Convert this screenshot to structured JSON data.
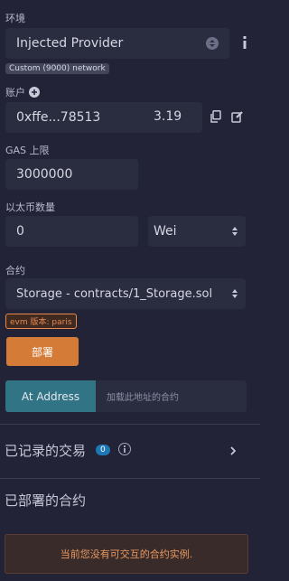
{
  "environment": {
    "label": "环境",
    "provider": "Injected Provider",
    "network_badge": "Custom (9000) network"
  },
  "account": {
    "label": "账户",
    "address": "0xffe...78513",
    "balance": "3.19"
  },
  "gas": {
    "label": "GAS 上限",
    "value": "3000000"
  },
  "value": {
    "label": "以太币数量",
    "amount": "0",
    "unit": "Wei"
  },
  "contract": {
    "label": "合约",
    "selected": "Storage - contracts/1_Storage.sol",
    "evm_badge": "evm 版本: paris"
  },
  "deploy": {
    "button": "部署"
  },
  "at_address": {
    "button": "At Address",
    "placeholder": "加载此地址的合约"
  },
  "transactions": {
    "title": "已记录的交易",
    "count": "0"
  },
  "deployed": {
    "title": "已部署的合约",
    "empty_message": "当前您没有可交互的合约实例."
  },
  "colors": {
    "background": "#222336",
    "field": "#2a2c3f",
    "deploy_button": "#d57b38",
    "at_address_button": "#307485",
    "badge_blue": "#1e78b5"
  }
}
